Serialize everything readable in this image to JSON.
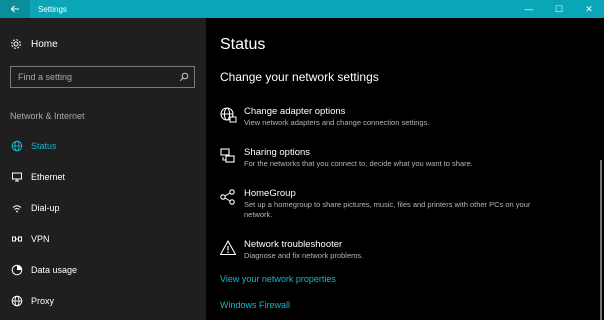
{
  "window": {
    "title": "Settings",
    "minimize": "—",
    "maximize": "☐",
    "close": "✕"
  },
  "sidebar": {
    "home": "Home",
    "search_placeholder": "Find a setting",
    "section": "Network & Internet",
    "items": [
      {
        "label": "Status",
        "icon": "globe-icon",
        "active": true
      },
      {
        "label": "Ethernet",
        "icon": "monitor-icon",
        "active": false
      },
      {
        "label": "Dial-up",
        "icon": "phone-icon",
        "active": false
      },
      {
        "label": "VPN",
        "icon": "vpn-icon",
        "active": false
      },
      {
        "label": "Data usage",
        "icon": "gauge-icon",
        "active": false
      },
      {
        "label": "Proxy",
        "icon": "globe-icon",
        "active": false
      }
    ]
  },
  "main": {
    "title": "Status",
    "subtitle": "Change your network settings",
    "options": [
      {
        "title": "Change adapter options",
        "desc": "View network adapters and change connection settings.",
        "icon": "adapter-globe-icon"
      },
      {
        "title": "Sharing options",
        "desc": "For the networks that you connect to, decide what you want to share.",
        "icon": "sharing-icon"
      },
      {
        "title": "HomeGroup",
        "desc": "Set up a homegroup to share pictures, music, files and printers with other PCs on your network.",
        "icon": "homegroup-icon"
      },
      {
        "title": "Network troubleshooter",
        "desc": "Diagnose and fix network problems.",
        "icon": "warning-icon"
      }
    ],
    "links": [
      "View your network properties",
      "Windows Firewall"
    ]
  },
  "colors": {
    "accent": "#12b8cc",
    "titlebar": "#0aa6b8",
    "sidebar_bg": "#1f1f1f",
    "main_bg": "#000000"
  }
}
